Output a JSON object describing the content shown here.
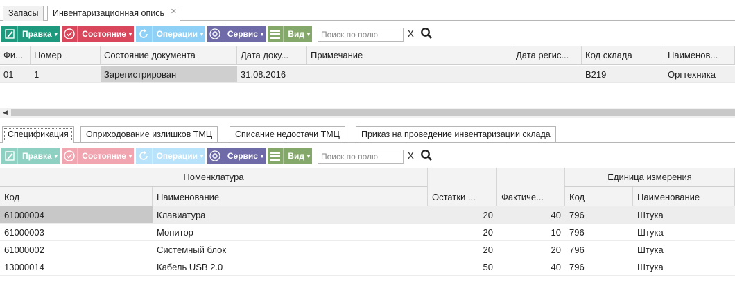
{
  "doc_tabs": [
    {
      "label": "Запасы"
    },
    {
      "label": "Инвентаризационная опись",
      "close": "✕"
    }
  ],
  "toolbar": {
    "edit": "Правка",
    "state": "Состояние",
    "operations": "Операции",
    "service": "Сервис",
    "view": "Вид",
    "search_placeholder": "Поиск по полю",
    "clear": "X"
  },
  "main_grid": {
    "columns": [
      "Фи...",
      "Номер",
      "Состояние документа",
      "Дата доку...",
      "Примечание",
      "Дата регис...",
      "Код склада",
      "Наименов..."
    ],
    "rows": [
      {
        "fi": "01",
        "number": "1",
        "state": "Зарегистрирован",
        "doc_date": "31.08.2016",
        "note": "",
        "reg_date": "",
        "warehouse_code": "B219",
        "warehouse_name": "Оргтехника"
      }
    ]
  },
  "sub_tabs": [
    {
      "label": "Спецификация"
    },
    {
      "label": "Оприходование излишков ТМЦ"
    },
    {
      "label": "Списание недостачи ТМЦ"
    },
    {
      "label": "Приказ на проведение инвентаризации склада"
    }
  ],
  "toolbar2": {
    "edit": "Правка",
    "state": "Состояние",
    "operations": "Операции",
    "service": "Сервис",
    "view": "Вид",
    "search_placeholder": "Поиск по полю",
    "clear": "X"
  },
  "spec_grid": {
    "group_nomenclature": "Номенклатура",
    "group_unit": "Единица измерения",
    "columns": {
      "code": "Код",
      "name": "Наименование",
      "stock": "Остатки ...",
      "actual": "Фактиче...",
      "unit_code": "Код",
      "unit_name": "Наименование"
    },
    "rows": [
      {
        "code": "61000004",
        "name": "Клавиатура",
        "stock": "20",
        "actual": "40",
        "unit_code": "796",
        "unit_name": "Штука"
      },
      {
        "code": "61000003",
        "name": "Монитор",
        "stock": "20",
        "actual": "10",
        "unit_code": "796",
        "unit_name": "Штука"
      },
      {
        "code": "61000002",
        "name": "Системный блок",
        "stock": "20",
        "actual": "20",
        "unit_code": "796",
        "unit_name": "Штука"
      },
      {
        "code": "13000014",
        "name": "Кабель USB 2.0",
        "stock": "50",
        "actual": "40",
        "unit_code": "796",
        "unit_name": "Штука"
      }
    ]
  },
  "colors": {
    "edit": "#1d9a7e",
    "state": "#d9475c",
    "operations": "#8fd0f6",
    "service": "#6f6aa8",
    "view": "#84a86a"
  }
}
